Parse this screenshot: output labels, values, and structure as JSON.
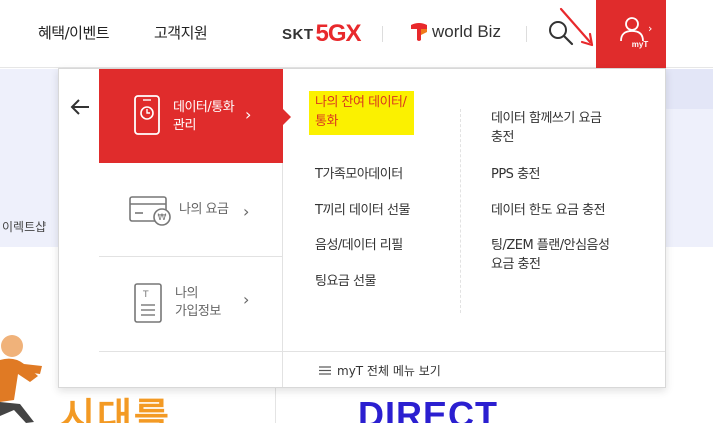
{
  "header": {
    "nav": [
      {
        "label": "혜택/이벤트"
      },
      {
        "label": "고객지원"
      }
    ],
    "brands": {
      "skt": "SKT",
      "fiveg": "5GX",
      "worldbiz": "world Biz"
    },
    "myt_label": "myT"
  },
  "background": {
    "shop_text": "이렉트샵",
    "promo_left": "시대를",
    "promo_right": "DIRECT"
  },
  "dropdown": {
    "left_menu": [
      {
        "label": "데이터/통화\n관리",
        "icon": "phone-clock-icon"
      },
      {
        "label": "나의 요금",
        "icon": "credit-card-won-icon"
      },
      {
        "label": "나의\n가입정보",
        "icon": "document-icon"
      }
    ],
    "col_a": [
      {
        "label": "나의 잔여 데이터/\n통화"
      },
      {
        "label": "T가족모아데이터"
      },
      {
        "label": "T끼리 데이터 선물"
      },
      {
        "label": "음성/데이터 리필"
      },
      {
        "label": "팅요금 선물"
      }
    ],
    "col_b": [
      {
        "label": "데이터 함께쓰기 요금\n충전"
      },
      {
        "label": "PPS 충전"
      },
      {
        "label": "데이터 한도 요금 충전"
      },
      {
        "label": "팅/ZEM 플랜/안심음성\n요금 충전"
      }
    ],
    "footer_label": "myT 전체 메뉴 보기"
  },
  "colors": {
    "accent_red": "#e02c2c",
    "highlight_yellow": "#fbf100",
    "annotation_arrow": "#e8292c"
  }
}
